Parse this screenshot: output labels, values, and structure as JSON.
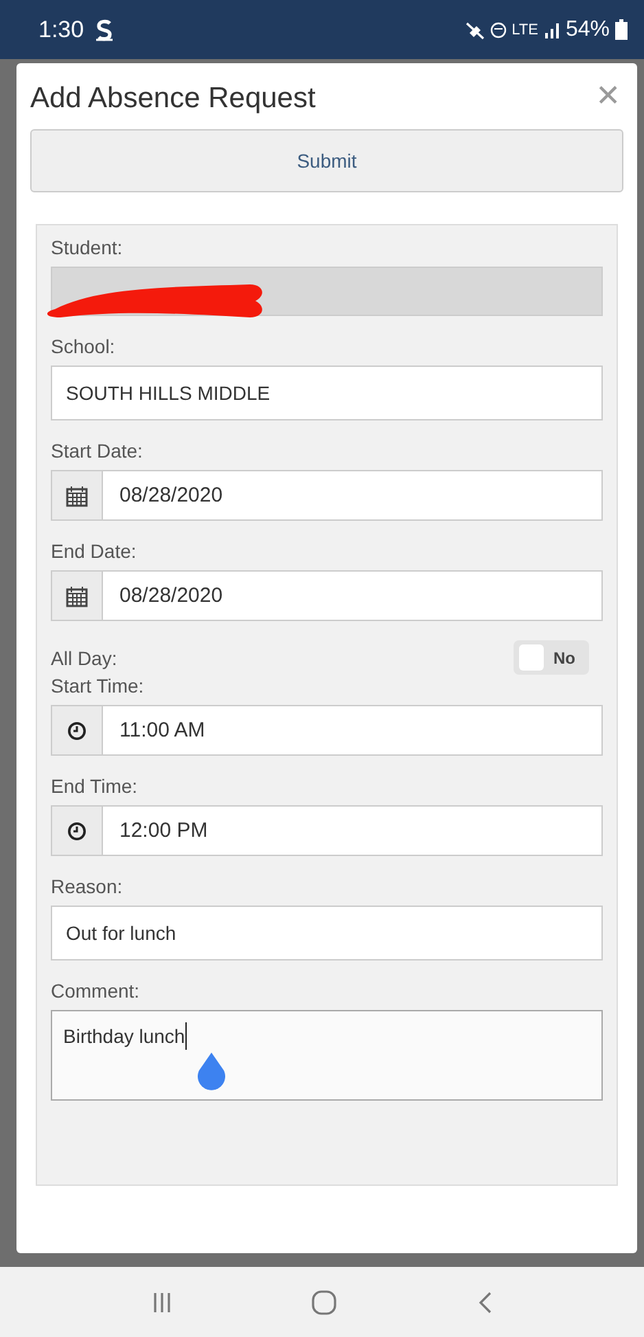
{
  "status_bar": {
    "time": "1:30",
    "network": "LTE",
    "battery": "54%"
  },
  "dialog": {
    "title": "Add Absence Request",
    "close": "✕",
    "submit": "Submit"
  },
  "fields": [
    {
      "kind": "readonly",
      "label": "Student:",
      "redacted": true
    },
    {
      "kind": "text",
      "label": "School:",
      "value": "SOUTH HILLS MIDDLE"
    },
    {
      "kind": "date",
      "label": "Start Date:",
      "value": "08/28/2020"
    },
    {
      "kind": "date",
      "label": "End Date:",
      "value": "08/28/2020"
    },
    {
      "kind": "toggle",
      "label": "All Day:",
      "on": false,
      "value": "No"
    },
    {
      "kind": "time",
      "label": "Start Time:",
      "value": "11:00 AM"
    },
    {
      "kind": "time",
      "label": "End Time:",
      "value": "12:00 PM"
    },
    {
      "kind": "text",
      "label": "Reason:",
      "value": "Out for lunch"
    },
    {
      "kind": "textarea",
      "label": "Comment:",
      "value": "Birthday lunch",
      "focused": true
    }
  ]
}
